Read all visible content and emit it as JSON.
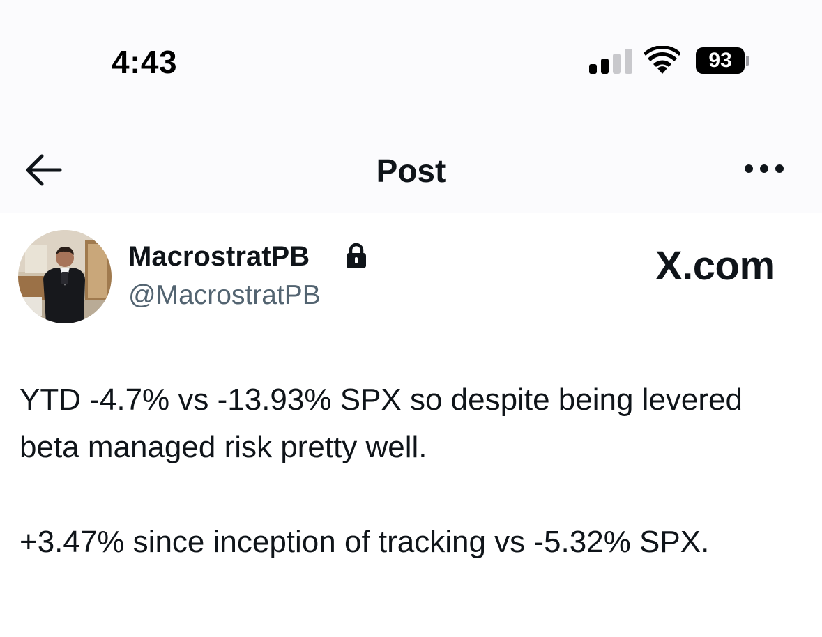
{
  "status_bar": {
    "time": "4:43",
    "battery_level": "93",
    "signal_bars_active": 2,
    "signal_bars_total": 4
  },
  "nav": {
    "title": "Post",
    "back_icon": "arrow-left-icon",
    "more_icon": "more-horizontal-icon"
  },
  "post": {
    "author": {
      "display_name": "MacrostratPB",
      "handle": "@MacrostratPB",
      "protected_icon": "lock-icon"
    },
    "brand_watermark": "X.com",
    "body": {
      "paragraph_1": "YTD -4.7% vs -13.93% SPX so despite being levered beta managed risk pretty well.",
      "paragraph_2": "+3.47% since inception of tracking vs -5.32% SPX."
    }
  },
  "colors": {
    "text_primary": "#0f1419",
    "text_secondary": "#536471",
    "header_background": "#fbfbfd"
  }
}
